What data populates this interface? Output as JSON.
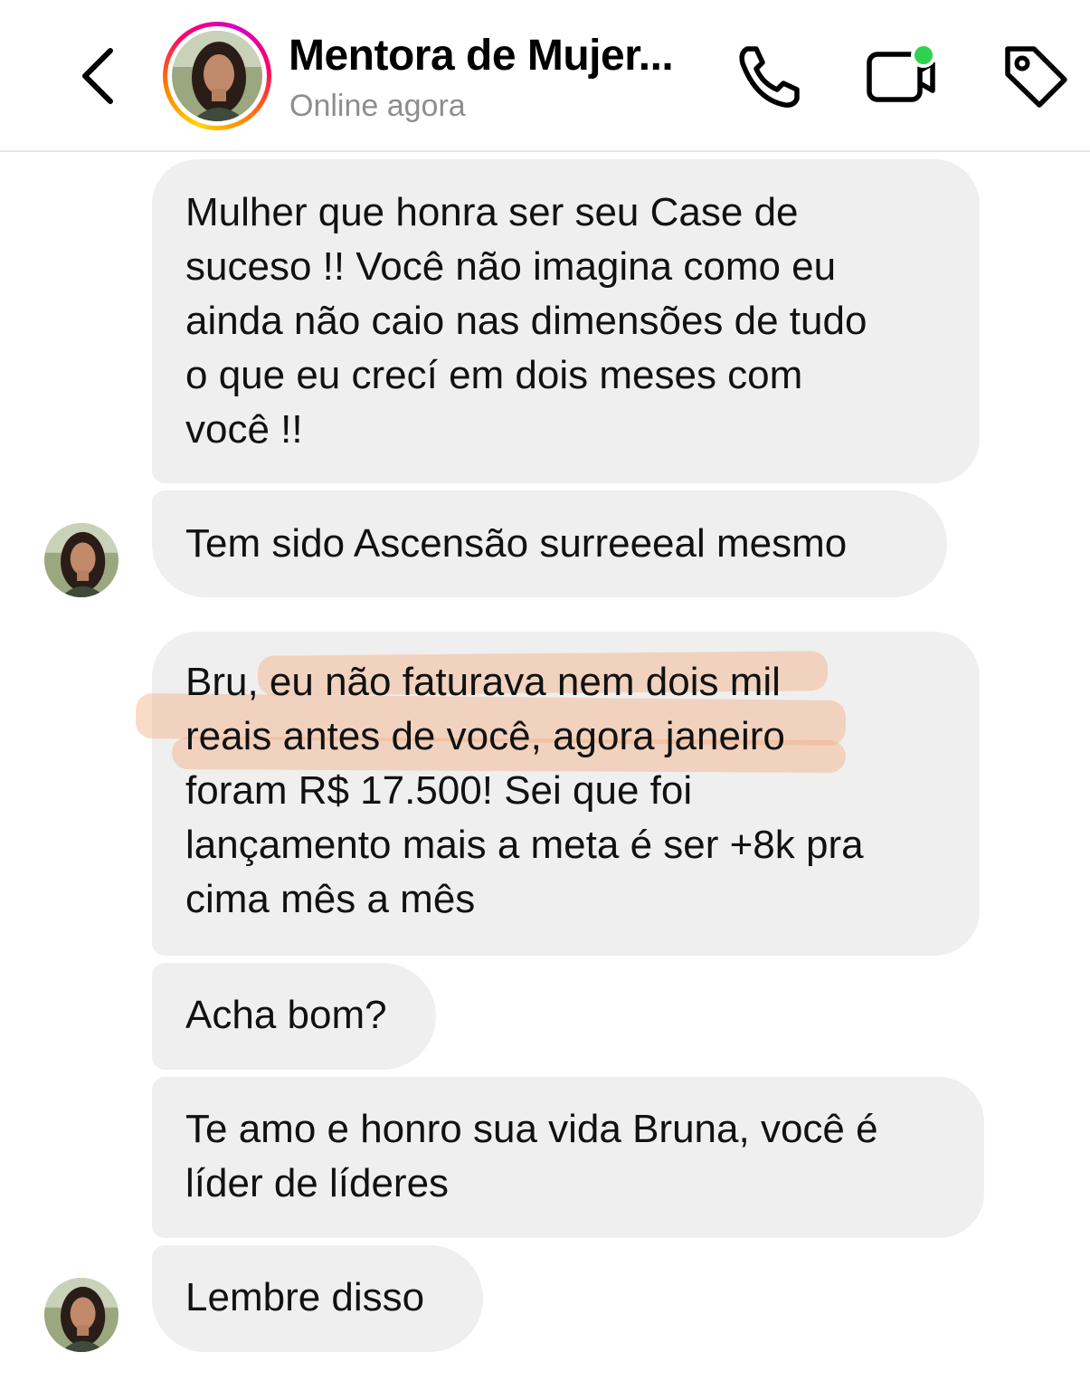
{
  "header": {
    "contact_name": "Mentora de Mujer...",
    "status": "Online agora",
    "icons": [
      "back-chevron-icon",
      "phone-icon",
      "video-call-icon",
      "tag-icon"
    ],
    "video_indicator_color": "#2fd24d",
    "story_ring_colors": [
      "#ffd600",
      "#ff7a00",
      "#ff0069",
      "#d300c5"
    ]
  },
  "messages": [
    {
      "text_lines": [
        "Mulher que honra ser seu Case de",
        "suceso !! Você não imagina como eu",
        "ainda não caio nas dimensões de tudo",
        "o que eu crecí em dois meses com",
        "você !!"
      ]
    },
    {
      "text_lines": [
        "Tem sido Ascensão surreeeal mesmo"
      ]
    },
    {
      "text_lines": [
        "Bru, eu não faturava nem dois mil",
        "reais antes de você, agora janeiro",
        "foram R$ 17.500! Sei que foi",
        "lançamento mais a meta é ser +8k pra",
        "cima mês a mês"
      ]
    },
    {
      "text_lines": [
        "Acha bom?"
      ]
    },
    {
      "text_lines": [
        "Te amo e honro sua vida Bruna, você é",
        "líder de líderes"
      ]
    },
    {
      "text_lines": [
        "Lembre disso"
      ]
    }
  ],
  "colors": {
    "bubble_bg": "#efefef",
    "highlight": "#f3af82",
    "status_text": "#8e8e8e"
  }
}
